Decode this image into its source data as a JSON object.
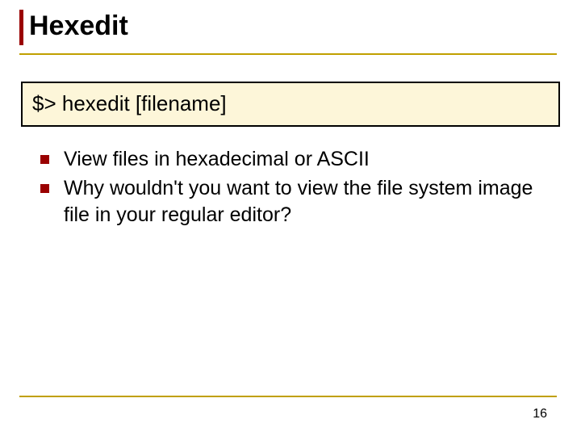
{
  "slide": {
    "title": "Hexedit",
    "code": "$> hexedit [filename]",
    "bullets": [
      "View files in hexadecimal or ASCII",
      "Why wouldn't you want to view the file system image file in your regular editor?"
    ],
    "page_number": "16"
  }
}
